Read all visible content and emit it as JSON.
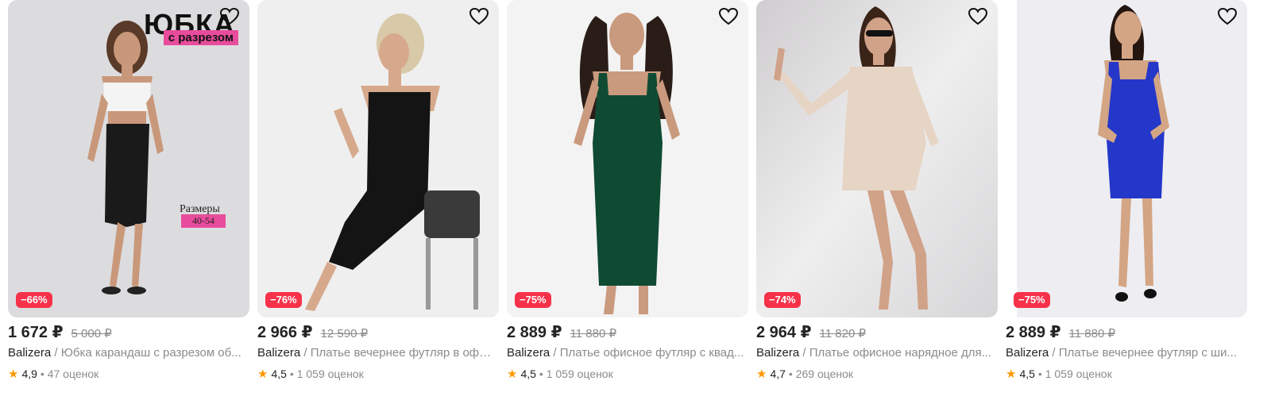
{
  "products": [
    {
      "discount": "−66%",
      "price": "1 672 ₽",
      "old_price": "5 000 ₽",
      "brand": "Balizera",
      "name": " / Юбка карандаш с разрезом об...",
      "rating": "4,9",
      "reviews": "• 47 оценок",
      "promo_title": "ЮБКА",
      "promo_sub": "с разрезом",
      "sizes_label": "Размеры",
      "sizes_value": "40-54",
      "garment_color": "#1a1a1a",
      "bg_color": "#d9d9dd"
    },
    {
      "discount": "−76%",
      "price": "2 966 ₽",
      "old_price": "12 590 ₽",
      "brand": "Balizera",
      "name": " / Платье вечернее футляр в офи...",
      "rating": "4,5",
      "reviews": "• 1 059 оценок",
      "garment_color": "#111111",
      "bg_color": "#e7e7e8"
    },
    {
      "discount": "−75%",
      "price": "2 889 ₽",
      "old_price": "11 880 ₽",
      "brand": "Balizera",
      "name": " / Платье офисное футляр с квад...",
      "rating": "4,5",
      "reviews": "• 1 059 оценок",
      "garment_color": "#0f4a33",
      "bg_color": "#f2f2f2"
    },
    {
      "discount": "−74%",
      "price": "2 964 ₽",
      "old_price": "11 820 ₽",
      "brand": "Balizera",
      "name": " / Платье офисное нарядное для...",
      "rating": "4,7",
      "reviews": "• 269 оценок",
      "garment_color": "#e6d5c4",
      "bg_color": "#e4e3e4"
    },
    {
      "discount": "−75%",
      "price": "2 889 ₽",
      "old_price": "11 880 ₽",
      "brand": "Balizera",
      "name": " / Платье вечернее футляр с ши...",
      "rating": "4,5",
      "reviews": "• 1 059 оценок",
      "garment_color": "#2437c9",
      "bg_color": "#ededf2"
    }
  ],
  "icons": {
    "favorite": "heart-outline-icon",
    "rating": "star-icon"
  },
  "colors": {
    "discount_badge": "#f6324a",
    "rating_star": "#ff9900",
    "promo_pink": "#e84c9c"
  }
}
